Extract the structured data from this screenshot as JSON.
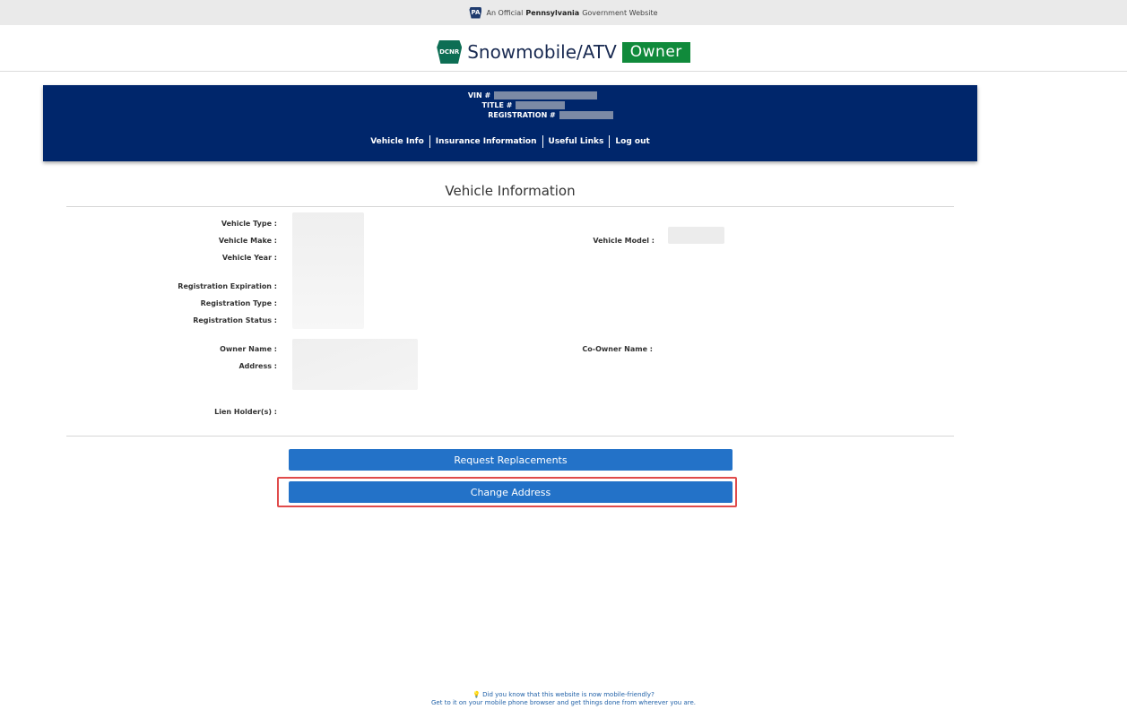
{
  "gov_banner": {
    "logo": "PA",
    "prefix": "An Official",
    "state": "Pennsylvania",
    "suffix": "Government Website"
  },
  "brand": {
    "logo_text": "DCNR",
    "title": "Snowmobile/ATV",
    "badge": "Owner"
  },
  "vehicle_header": {
    "vin_label": "VIN #",
    "title_label": "TITLE #",
    "registration_label": "REGISTRATION #",
    "nav": [
      "Vehicle Info",
      "Insurance Information",
      "Useful Links",
      "Log out"
    ]
  },
  "section": {
    "title": "Vehicle Information"
  },
  "fields": {
    "vehicle_type": "Vehicle Type :",
    "vehicle_make": "Vehicle Make :",
    "vehicle_model": "Vehicle Model :",
    "vehicle_year": "Vehicle Year :",
    "registration_expiration": "Registration Expiration :",
    "registration_type": "Registration Type :",
    "registration_status": "Registration Status :",
    "owner_name": "Owner Name :",
    "co_owner_name": "Co-Owner Name :",
    "address": "Address :",
    "lien_holders": "Lien Holder(s) :"
  },
  "actions": {
    "request_replacements": "Request Replacements",
    "change_address": "Change Address"
  },
  "footer": {
    "line1": "Did you know that this website is now mobile-friendly?",
    "line2": "Get to it on your mobile phone browser and get things done from wherever you are."
  },
  "colors": {
    "header_blue": "#00266b",
    "button_blue": "#2372c8",
    "owner_green": "#108a3b",
    "highlight_red": "#e04b4b"
  },
  "icons": [
    "pa-keystone-icon",
    "dcnr-keystone-icon",
    "lightbulb-icon"
  ]
}
